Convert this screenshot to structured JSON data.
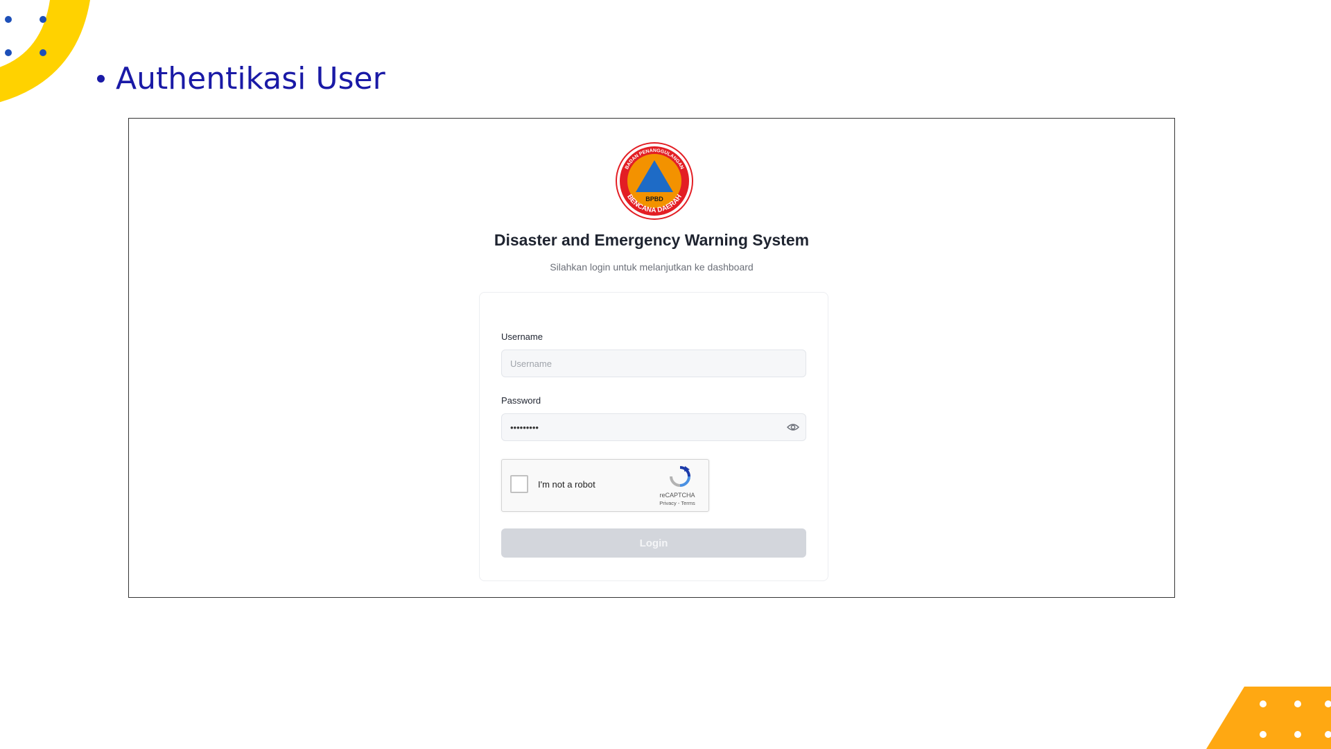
{
  "slide": {
    "heading": "Authentikasi User"
  },
  "colors": {
    "heading": "#1a1aa6",
    "deco_yellow": "#FFD200",
    "deco_orange": "#FFA812",
    "deco_dots": "#1D4FB8",
    "logo_orange": "#F39200",
    "logo_blue": "#1E6BC6",
    "logo_red": "#E31E24"
  },
  "logo": {
    "name": "bpbd-logo",
    "top_text": "BADAN PENANGGULANGAN",
    "bottom_text": "BENCANA DAERAH",
    "center_text": "BPBD"
  },
  "login_page": {
    "title": "Disaster and Emergency Warning System",
    "subtitle": "Silahkan login untuk melanjutkan ke dashboard",
    "username": {
      "label": "Username",
      "placeholder": "Username",
      "value": ""
    },
    "password": {
      "label": "Password",
      "placeholder": "",
      "value": "*********"
    },
    "captcha": {
      "label": "I'm not a robot",
      "brand": "reCAPTCHA",
      "privacy": "Privacy",
      "separator": " - ",
      "terms": "Terms",
      "checked": false
    },
    "login_button": "Login"
  }
}
